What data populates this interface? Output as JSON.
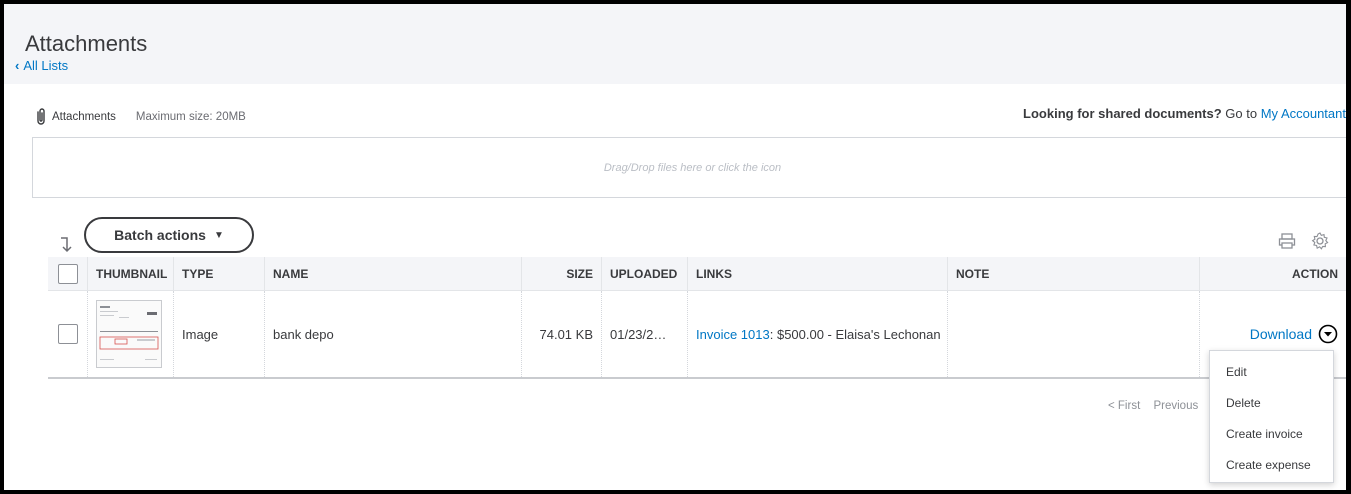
{
  "header": {
    "title": "Attachments",
    "back_label": "All Lists"
  },
  "attach_bar": {
    "label": "Attachments",
    "max_size": "Maximum size: 20MB"
  },
  "shared": {
    "prompt": "Looking for shared documents?",
    "goto": "Go to",
    "link": "My Accountant"
  },
  "dropzone": {
    "text": "Drag/Drop files here or click the icon"
  },
  "toolbar": {
    "batch_label": "Batch actions",
    "batch_caret": "▼"
  },
  "table": {
    "columns": [
      "THUMBNAIL",
      "TYPE",
      "NAME",
      "SIZE",
      "UPLOADED",
      "LINKS",
      "NOTE",
      "ACTION"
    ],
    "rows": [
      {
        "type": "Image",
        "name": "bank depo",
        "size": "74.01 KB",
        "uploaded": "01/23/2…",
        "link_text": "Invoice 1013",
        "link_rest": ": $500.00 - Elaisa's Lechonan",
        "note": "",
        "action": "Download"
      }
    ]
  },
  "action_menu": {
    "items": [
      "Edit",
      "Delete",
      "Create invoice",
      "Create expense"
    ]
  },
  "pager": {
    "first": "< First",
    "previous": "Previous"
  },
  "colors": {
    "link": "#0077c5",
    "text": "#393a3d",
    "header_bg": "#f4f5f8"
  }
}
